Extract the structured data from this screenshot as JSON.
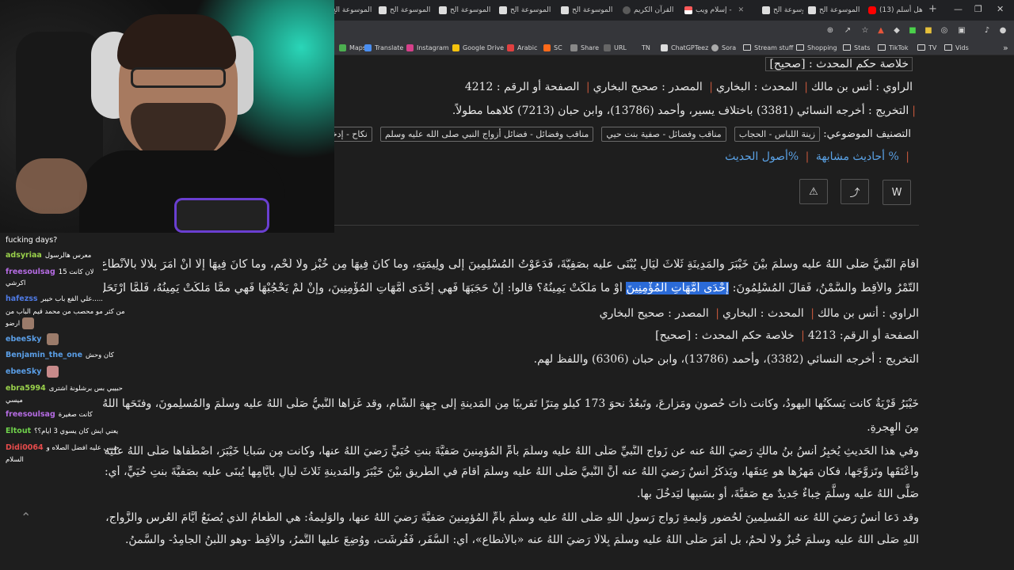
{
  "browser": {
    "tabs": [
      {
        "label": "الموسوعة الح",
        "icon": "page-icon"
      },
      {
        "label": "الموسوعة الح",
        "icon": "page-icon"
      },
      {
        "label": "الموسوعة الح",
        "icon": "page-icon"
      },
      {
        "label": "الموسوعة الح",
        "icon": "page-icon"
      },
      {
        "label": "الموسوعة الح",
        "icon": "page-icon"
      },
      {
        "label": "القرآن الكريم",
        "icon": "quran-icon"
      },
      {
        "label": "إسلام ويب -",
        "icon": "flag-icon"
      },
      {
        "label": "الموسوعة الح",
        "icon": "page-icon"
      },
      {
        "label": "الموسوعة الح",
        "icon": "page-icon"
      },
      {
        "label": "(13) هل أسلم",
        "icon": "youtube-icon"
      }
    ],
    "bookmarks": [
      {
        "label": "Maps",
        "icon": "maps-icon"
      },
      {
        "label": "Translate",
        "icon": "translate-icon"
      },
      {
        "label": "Instagram",
        "icon": "instagram-icon"
      },
      {
        "label": "Google Drive",
        "icon": "drive-icon"
      },
      {
        "label": "Arabic",
        "icon": "arabic-icon"
      },
      {
        "label": "SC",
        "icon": "sc-icon"
      },
      {
        "label": "Share",
        "icon": "share-icon"
      },
      {
        "label": "URL",
        "icon": "url-icon"
      },
      {
        "label": "TN",
        "icon": "tn-icon"
      },
      {
        "label": "ChatGPTeez",
        "icon": "chatgpt-icon"
      },
      {
        "label": "Sora",
        "icon": "sora-icon"
      },
      {
        "label": "Stream stuff",
        "icon": "folder-icon"
      },
      {
        "label": "Shopping",
        "icon": "folder-icon"
      },
      {
        "label": "Stats",
        "icon": "folder-icon"
      },
      {
        "label": "TikTok",
        "icon": "folder-icon"
      },
      {
        "label": "TV",
        "icon": "folder-icon"
      },
      {
        "label": "Vids",
        "icon": "folder-icon"
      }
    ]
  },
  "hadith1": {
    "ruling_label": "خلاصة حكم المحدث : [صحيح]",
    "rawi": "الراوي : أنس بن مالك",
    "muhaddith": "المحدث : البخاري",
    "source": "المصدر : صحيح البخاري",
    "page": "الصفحة أو الرقم : 4212",
    "takhrij": "التخريج : أخرجه النسائي (3381) باختلاف يسير، وأحمد (13786)، وابن حبان (7213) كلاهما مطولاً.",
    "topics_label": "التصنيف الموضوعي:",
    "topics": [
      "زينة اللباس - الحجاب",
      "مناقب وفضائل - صفية بنت حيي",
      "مناقب وفضائل - فضائل أزواج النبي صلى الله عليه وسلم",
      "نكاح - إدخال المرأة على"
    ],
    "similar_link": "% أحاديث مشابهة",
    "usul_link": "%أصول الحديث"
  },
  "actions": {
    "report": "⚠",
    "share": "⤴",
    "word": "W"
  },
  "hadith2": {
    "line1": "أقامَ النَّبيُّ صَلَّى اللهُ عليه وسلَّمَ بيْنَ خَيْبَرَ والمَدِينَةِ ثَلَاثَ لَيَالٍ يُبْنَى عليه بصَفِيَّةَ، فَدَعَوْتُ المُسْلِمِينَ إلى ولِيمَتِهِ، وما كانَ فِيهَا مِن خُبْزٍ ولَا لَحْمٍ، وما كانَ فِيهَا إلَّا أنْ أمَرَ بلَالًا بالأنْطَاعِ فَبُسِطَتْ، فأُلْقِيَ عليها",
    "line2_before": "التَّمْرُ والأقِطُ والسَّمْنُ، فَقالَ المُسْلِمُونَ:",
    "line2_highlight": "إحْدَى أُمَّهَاتِ المُؤْمِنِينَ",
    "line2_after": "أوْ ما مَلَكَتْ يَمِينُهُ؟ قالوا: إنْ حَجَبَهَا فَهي إحْدَى أُمَّهَاتِ المُؤْمِنِينَ، وإنْ لَمْ يَحْجُبْهَا فَهي ممَّا مَلَكَتْ يَمِينُهُ، فَلَمَّا ارْتَحَلَ وطَّأَ لَهَا خَلْفَهُ ومَدَّ الحِجَابَ.",
    "rawi": "الراوي : أنس بن مالك",
    "muhaddith": "المحدث : البخاري",
    "source": "المصدر : صحيح البخاري",
    "page": "الصفحة أو الرقم: 4213",
    "ruling": "خلاصة حكم المحدث : [صحيح]",
    "takhrij": "التخريج : أخرجه النسائي (3382)، وأحمد (13786)، وابن حبان (6306) واللفظ لهم."
  },
  "sharh": {
    "p1_line1": "خَيْبَرُ قَرْيَةٌ كانت يَسكُنُها اليهودُ، وكانت ذاتَ حُصونٍ ومَزارِعَ، وتَبعُدُ نحوَ 173 كيلو مِترًا تَقريبًا مِن المَدينةِ إلى جِهةِ الشَّامِ، وقد غَزاها النَّبيُّ صَلَّى اللهُ عليه وسلَّمَ والمُسلِمونَ، وفتَحَها اللهُ لهم في السَّنةِ السَّابعةِ",
    "p1_line2": "مِنَ الهِجرةِ.",
    "p2_line1": "وفي هذا الحَديثِ يُخبِرُ أنسُ بنُ مالكٍ رَضيَ اللهُ عنه عن زَواجِ النَّبيِّ صَلَّى اللهُ عليه وسلَّمَ بأُمِّ المُؤمِنينَ صَفيَّةَ بنتِ حُيَيٍّ رَضيَ اللهُ عنها، وكانت مِن سَبايا خَيْبَرَ، اصْطَفاها صَلَّى اللهُ عليه وسلَّمَ لنَفْسِه،",
    "p2_line2": "وأعْتَقَها وتَزوَّجَها، فكان مَهرُها هو عِتقَها، ويَذكُرُ أنسٌ رَضيَ اللهُ عنه أنَّ النَّبيَّ صَلَّى اللهُ عليه وسلَّمَ أقامَ في الطَّريقِ بيْنَ خَيْبَرَ والمَدينةِ ثَلاثَ لَيالٍ بأيَّامِها يُبنَى عليه بصَفيَّةَ بنتِ حُيَيٍّ، أي: يُبنَى لرَسولِ اللهِ",
    "p2_line3": "صَلَّى اللهُ عليه وسلَّمَ خِباءٌ جَديدٌ مع صَفيَّةَ، أو بسَببِها ليَدخُلَ بها.",
    "p3_line1": "وقد دَعا أنسٌ رَضيَ اللهُ عنه المُسلِمينَ لحُضورِ وَليمةِ زَواجِ رَسولِ اللهِ صَلَّى اللهُ عليه وسلَّمَ بأمِّ المُؤمِنينَ صَفيَّةَ رَضيَ اللهُ عنها، والوَليمةُ: هي الطَّعامُ الذي يُصنَعُ أيَّامَ العُرسِ والزَّواجِ، ولم يكُنْ في وَليمةِ رَسولِ",
    "p3_line2": "اللهِ صَلَّى اللهُ عليه وسلَّمَ خُبزٌ ولا لَحمٌ، بل أمَرَ صَلَّى اللهُ عليه وسلَّمَ بِلالًا رَضيَ اللهُ عنه «بالأنطاعِ»، أي: السُّفَرِ، فَفُرِشَت، ووُضِعَ عليها التَّمرُ، والأقِطُ -وهو اللَّبنُ الجامِدُ- والسَّمنُ."
  },
  "chat": {
    "messages": [
      {
        "user": "",
        "text": "fucking days?",
        "color": "#ffffff"
      },
      {
        "user": "adsyriaa",
        "text": "معرس هالرسول",
        "color": "#9ad14b"
      },
      {
        "user": "freesoulsag",
        "text": "لان كانت 15",
        "color": "#b46be2"
      },
      {
        "user": "",
        "text": "اكرشي",
        "color": "#ffffff"
      },
      {
        "user": "hafezss",
        "text": "علي الفع باب خيبر.....",
        "color": "#4f7be6"
      },
      {
        "user": "",
        "text": "من كثر مو محصب من محمد قيم الباب من",
        "color": "#ffffff"
      },
      {
        "user": "",
        "text": "ارضو",
        "color": "#ffffff"
      },
      {
        "user": "ebeeSky",
        "text": "",
        "color": "#5a9ee6"
      },
      {
        "user": "Benjamin_the_one",
        "text": "كان وحش",
        "color": "#5a9ee6"
      },
      {
        "user": "ebeeSky",
        "text": "",
        "color": "#5a9ee6"
      },
      {
        "user": "ebra5994",
        "text": "حبيبي بس برشلونة اشترى",
        "color": "#9ad14b"
      },
      {
        "user": "",
        "text": "ميسي",
        "color": "#ffffff"
      },
      {
        "user": "freesoulsag",
        "text": "كانت صغيرة",
        "color": "#b46be2"
      },
      {
        "user": "Eltout",
        "text": "يعني ايش كان يسوي 3 ايام؟؟",
        "color": "#6fd14b"
      },
      {
        "user": "Didi0064",
        "text": "حبيبي عليه افضل الصلاه و",
        "color": "#e64b4b"
      },
      {
        "user": "",
        "text": "السلام",
        "color": "#ffffff"
      }
    ]
  }
}
